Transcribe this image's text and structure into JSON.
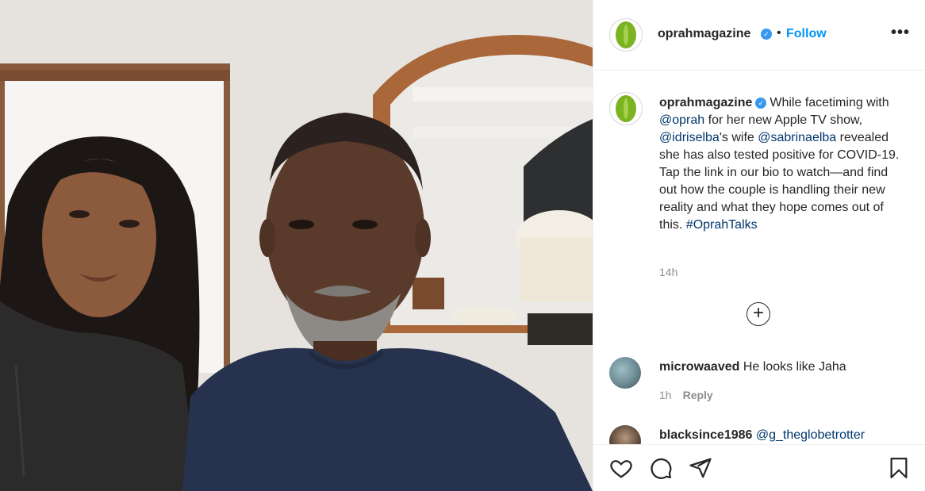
{
  "post": {
    "username": "oprahmagazine",
    "follow_label": "Follow",
    "dot": "•",
    "more_label": "•••",
    "verified_mark": "✓"
  },
  "caption": {
    "username": "oprahmagazine",
    "text_1": "While facetiming with ",
    "mention_1": "@oprah",
    "text_2": " for her new Apple TV show, ",
    "mention_2": "@idriselba",
    "text_3": "'s wife ",
    "mention_3": "@sabrinaelba",
    "text_4": " revealed she has also tested positive for COVID-19. Tap the link in our bio to watch—and find out how the couple is handling their new reality and what they hope comes out of this. ",
    "hashtag": "#OprahTalks",
    "time": "14h"
  },
  "load_more_label": "+",
  "comments": [
    {
      "username": "microwaaved",
      "text": "He looks like Jaha",
      "time": "1h",
      "reply_label": "Reply",
      "avatar_color": "#6b8a93"
    },
    {
      "username": "blacksince1986",
      "mention": "@g_theglobetrotter",
      "avatar_color": "#5a4638"
    }
  ],
  "icons": {
    "like": "heart-icon",
    "comment": "comment-icon",
    "share": "share-icon",
    "save": "bookmark-icon"
  },
  "colors": {
    "accent": "#0095f6",
    "verified": "#3897f0",
    "logo_green": "#7bb321",
    "mention": "#00376b"
  }
}
